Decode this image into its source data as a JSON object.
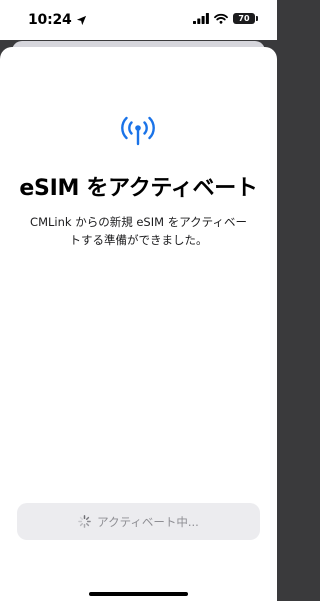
{
  "status_bar": {
    "time": "10:24",
    "battery_level": "70",
    "icons": [
      "location-arrow-icon",
      "signal-icon",
      "wifi-icon",
      "battery-icon"
    ]
  },
  "sheet": {
    "icon": "antenna-signal-icon",
    "title": "eSIM をアクティベート",
    "description": "CMLink からの新規 eSIM をアクティベートする準備ができました。",
    "button": {
      "label": "アクティベート中...",
      "icon": "spinner-icon",
      "state": "disabled"
    }
  },
  "colors": {
    "accent": "#1a73e8",
    "button_background": "#ececef",
    "button_text": "#8e8e93"
  }
}
